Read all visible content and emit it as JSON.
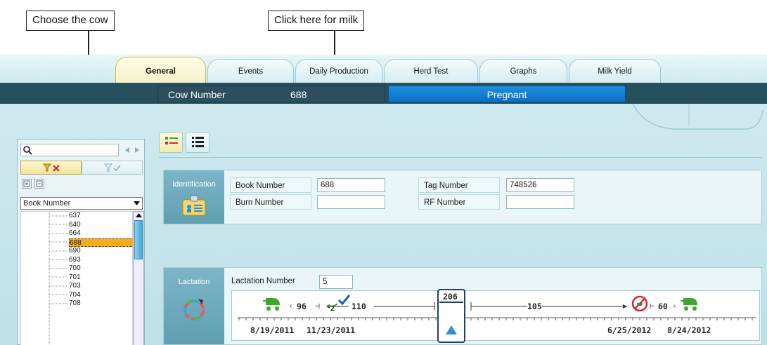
{
  "callouts": {
    "choose_cow": "Choose the cow",
    "click_milk": "Click here for milk"
  },
  "tabs": [
    {
      "label": "General",
      "active": true
    },
    {
      "label": "Events",
      "active": false
    },
    {
      "label": "Daily Production",
      "active": false
    },
    {
      "label": "Herd Test",
      "active": false
    },
    {
      "label": "Graphs",
      "active": false
    },
    {
      "label": "Milk Yield",
      "active": false
    }
  ],
  "header": {
    "cow_number_label": "Cow Number",
    "cow_number_value": "688",
    "status": "Pregnant"
  },
  "left_panel": {
    "search_value": "",
    "sort_select": "Book Number",
    "tree_items": [
      "637",
      "640",
      "664",
      "688",
      "690",
      "693",
      "700",
      "701",
      "703",
      "704",
      "708"
    ],
    "selected_item": "688"
  },
  "identification": {
    "section_label": "Identification",
    "book_number_label": "Book Number",
    "book_number_value": "688",
    "burn_number_label": "Burn Number",
    "burn_number_value": "",
    "tag_number_label": "Tag Number",
    "tag_number_value": "748526",
    "rf_number_label": "RF Number",
    "rf_number_value": ""
  },
  "lactation": {
    "section_label": "Lactation",
    "lactation_number_label": "Lactation Number",
    "lactation_number_value": "5",
    "timeline": {
      "days_calving_to_service": "96",
      "services": "2",
      "days_service_to_now": "110",
      "days_in_milk": "206",
      "days_now_to_dryoff": "105",
      "days_dry": "60",
      "calving_date": "8/19/2011",
      "service_date": "11/23/2011",
      "dryoff_date": "6/25/2012",
      "next_calving_date": "8/24/2012"
    }
  },
  "colors": {
    "accent_blue": "#1d8fe0",
    "header_dark": "#27505e",
    "selected_row": "#f5ac1e",
    "icon_green": "#3aa82a",
    "icon_red": "#d9262c"
  }
}
